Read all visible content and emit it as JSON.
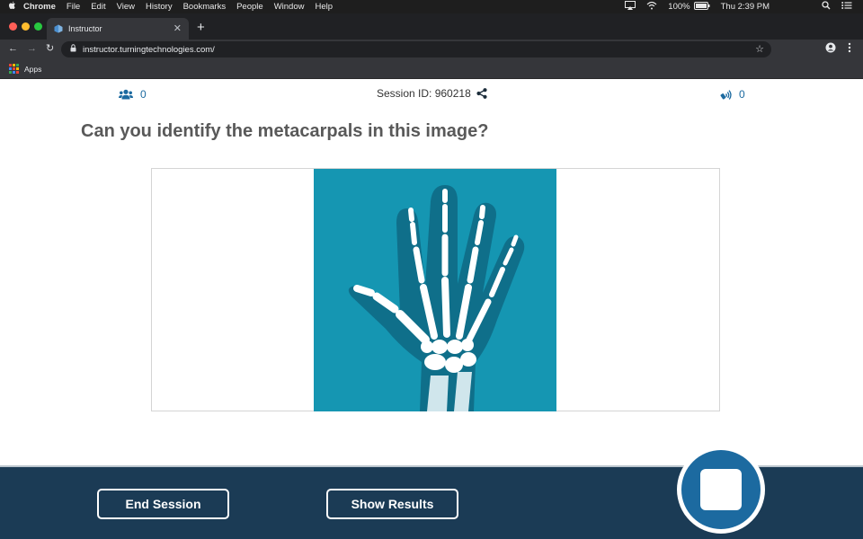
{
  "mac_menubar": {
    "app_name": "Chrome",
    "menus": [
      "File",
      "Edit",
      "View",
      "History",
      "Bookmarks",
      "People",
      "Window",
      "Help"
    ],
    "battery": "100%",
    "clock": "Thu 2:39 PM"
  },
  "browser": {
    "tab_title": "Instructor",
    "url": "instructor.turningtechnologies.com/",
    "bookmarks_apps_label": "Apps"
  },
  "header": {
    "participants_count": "0",
    "session_id_text": "Session ID: 960218",
    "responses_count": "0"
  },
  "question": {
    "text": "Can you identify the metacarpals in this image?",
    "image_icon": "hand-xray-image"
  },
  "footer": {
    "end_session_label": "End Session",
    "show_results_label": "Show Results",
    "stop_button_icon": "stop-icon"
  },
  "colors": {
    "accent": "#1c6aa0",
    "footer_bg": "#1b3b55",
    "xray_bg": "#1596b2"
  }
}
